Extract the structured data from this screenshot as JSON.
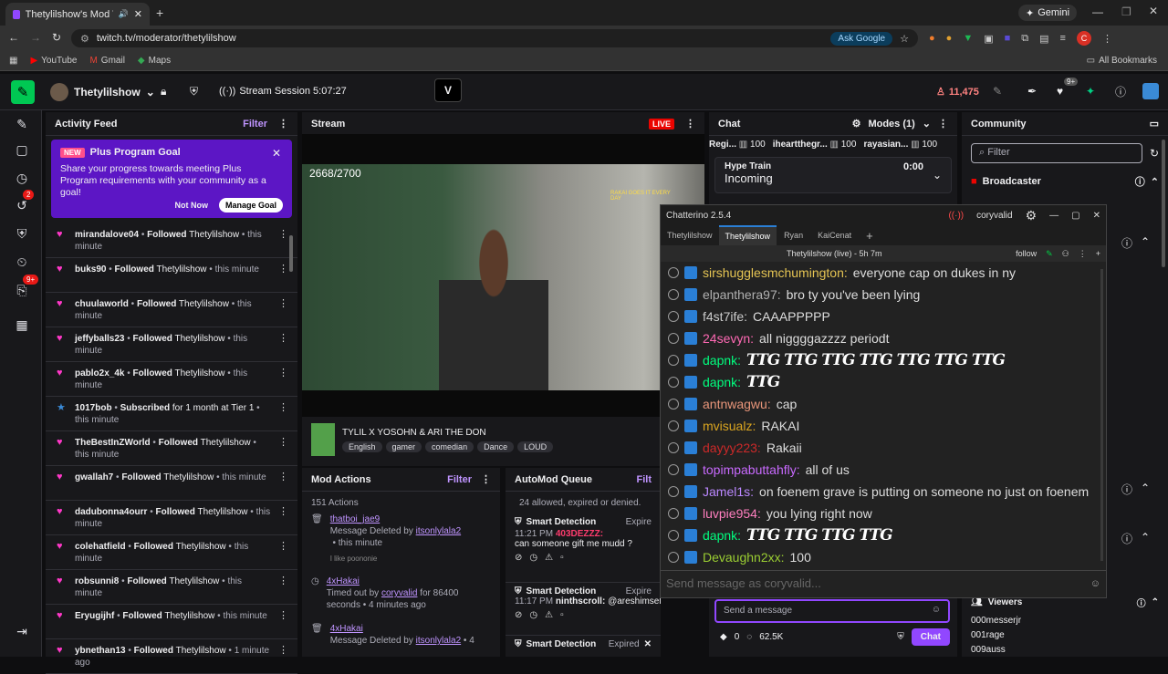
{
  "browser": {
    "tab_title": "Thetylilshow's Mod View -",
    "url": "twitch.tv/moderator/thetylilshow",
    "ask_google": "Ask Google",
    "gemini": "Gemini",
    "bookmarks": [
      "YouTube",
      "Gmail",
      "Maps"
    ],
    "all_bookmarks": "All Bookmarks",
    "profile_initial": "C"
  },
  "twitch": {
    "channel": "Thetylilshow",
    "session": "Stream Session 5:07:27",
    "viewers": "11,475",
    "notif_count": "9+"
  },
  "rail": {
    "badge1": "2",
    "badge2": "9+"
  },
  "activity": {
    "title": "Activity Feed",
    "filter": "Filter",
    "promo_badge": "NEW",
    "promo_title": "Plus Program Goal",
    "promo_text": "Share your progress towards meeting Plus Program requirements with your community as a goal!",
    "not_now": "Not Now",
    "manage": "Manage Goal",
    "items": [
      {
        "user": "mirandalove04",
        "action": "Followed",
        "target": "Thetylilshow",
        "time": "this minute"
      },
      {
        "user": "buks90",
        "action": "Followed",
        "target": "Thetylilshow",
        "time": "this minute"
      },
      {
        "user": "chuulaworld",
        "action": "Followed",
        "target": "Thetylilshow",
        "time": "this minute"
      },
      {
        "user": "jeffyballs23",
        "action": "Followed",
        "target": "Thetylilshow",
        "time": "this minute"
      },
      {
        "user": "pablo2x_4k",
        "action": "Followed",
        "target": "Thetylilshow",
        "time": "this minute"
      },
      {
        "user": "1017bob",
        "action": "Subscribed",
        "target": "for 1 month at Tier 1",
        "time": "this minute"
      },
      {
        "user": "TheBestInZWorld",
        "action": "Followed",
        "target": "Thetylilshow",
        "time": "this minute"
      },
      {
        "user": "gwallah7",
        "action": "Followed",
        "target": "Thetylilshow",
        "time": "this minute"
      },
      {
        "user": "dadubonna4ourr",
        "action": "Followed",
        "target": "Thetylilshow",
        "time": "this minute"
      },
      {
        "user": "colehatfield",
        "action": "Followed",
        "target": "Thetylilshow",
        "time": "this minute"
      },
      {
        "user": "robsunni8",
        "action": "Followed",
        "target": "Thetylilshow",
        "time": "this minute"
      },
      {
        "user": "Eryugijhf",
        "action": "Followed",
        "target": "Thetylilshow",
        "time": "this minute"
      },
      {
        "user": "ybnethan13",
        "action": "Followed",
        "target": "Thetylilshow",
        "time": "1 minute ago"
      }
    ]
  },
  "stream": {
    "title": "Stream",
    "live": "LIVE",
    "counter": "2668/2700",
    "stream_title": "TYLIL X YOSOHN & ARI THE DON",
    "tags": [
      "English",
      "gamer",
      "comedian",
      "Dance",
      "LOUD"
    ],
    "overlay_text": "RAKAI GOES IT EVERY DAY"
  },
  "mod": {
    "title": "Mod Actions",
    "filter": "Filter",
    "count": "151 Actions",
    "items": [
      {
        "user": "thatboi_jae9",
        "line": "Message Deleted by",
        "by": "itsonlylala2",
        "time": "this minute",
        "msg": "I like poononie"
      },
      {
        "user": "4xHakai",
        "line": "Timed out by",
        "by": "coryvalid",
        "extra": "for 86400 seconds",
        "time": "4 minutes ago"
      },
      {
        "user": "4xHakai",
        "line": "Message Deleted by",
        "by": "itsonlylala2",
        "time": "4"
      }
    ]
  },
  "automod": {
    "title": "AutoMod Queue",
    "filter": "Filt",
    "summary": "24 allowed, expired or denied.",
    "items": [
      {
        "kind": "Smart Detection",
        "status": "Expire",
        "time": "11:21 PM",
        "user": "403DEZZZ:",
        "msg": "can someone gift me mudd ?"
      },
      {
        "kind": "Smart Detection",
        "status": "Expire",
        "time": "11:17 PM",
        "user": "ninthscroll:",
        "msg": "@areshimselfr OF"
      },
      {
        "kind": "Smart Detection",
        "status": "Expired"
      }
    ]
  },
  "chat": {
    "title": "Chat",
    "modes": "Modes (1)",
    "hype_train": "Hype Train",
    "incoming": "Incoming",
    "timer": "0:00",
    "send_placeholder": "Send a message",
    "points": "0",
    "bits": "62.5K",
    "chat_btn": "Chat",
    "leaders": [
      {
        "name": "Regi...",
        "val": "100"
      },
      {
        "name": "iheartthegr...",
        "val": "100"
      },
      {
        "name": "rayasian...",
        "val": "100"
      }
    ]
  },
  "community": {
    "title": "Community",
    "filter_placeholder": "Filter",
    "broadcaster": "Broadcaster",
    "viewers": "Viewers",
    "viewer_list": [
      "000messerjr",
      "001rage",
      "009auss"
    ]
  },
  "chatterino": {
    "title": "Chatterino 2.5.4",
    "account": "coryvalid",
    "tabs": [
      "Thetylilshow",
      "Thetylilshow",
      "Ryan",
      "KaiCenat"
    ],
    "split_title": "Thetylilshow (live) - 5h 7m",
    "follow": "follow",
    "input_placeholder": "Send message as coryvalid...",
    "messages": [
      {
        "user": "sirshugglesmchumington:",
        "text": "everyone cap on dukes in ny",
        "color": "#e5c453"
      },
      {
        "user": "elpanthera97:",
        "text": "bro ty you've been lying",
        "color": "#b0b0b0"
      },
      {
        "user": "f4st7ife:",
        "text": "CAAAPPPPP",
        "color": "#cccccc"
      },
      {
        "user": "24sevyn:",
        "text": "all niggggazzzz periodt",
        "color": "#ff69b4"
      },
      {
        "user": "dapnk:",
        "text": "TTG TTG TTG TTG TTG TTG TTG",
        "color": "#00ff7f",
        "emote": true
      },
      {
        "user": "dapnk:",
        "text": "TTG",
        "color": "#00ff7f",
        "emote": true
      },
      {
        "user": "antnwagwu:",
        "text": "cap",
        "color": "#e9967a"
      },
      {
        "user": "mvisualz:",
        "text": "RAKAI",
        "color": "#daa520"
      },
      {
        "user": "dayyy223:",
        "text": "Rakaii",
        "color": "#cc2929"
      },
      {
        "user": "topimpabuttahfly:",
        "text": "all of us",
        "color": "#c96aff"
      },
      {
        "user": "Jamel1s:",
        "text": "on foenem grave is putting on someone no just on foenem",
        "color": "#bb88ff"
      },
      {
        "user": "luvpie954:",
        "text": "you lying right now",
        "color": "#ff7fbf"
      },
      {
        "user": "dapnk:",
        "text": "TTG TTG TTG TTG",
        "color": "#00ff7f",
        "emote": true
      },
      {
        "user": "Devaughn2xx:",
        "text": "100",
        "color": "#9acd32"
      }
    ]
  },
  "colors": {
    "twitch_purple": "#9147ff",
    "live_red": "#eb0400",
    "chatterino_badge": "#2a7fd6"
  }
}
